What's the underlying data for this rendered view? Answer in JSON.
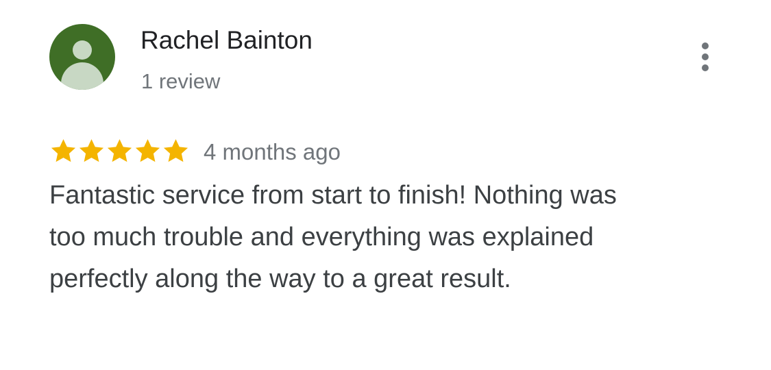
{
  "reviewer": {
    "name": "Rachel Bainton",
    "review_count": "1 review",
    "avatar_color": "#3f6e26"
  },
  "review": {
    "rating": 5,
    "max_rating": 5,
    "star_color": "#f4b400",
    "date": "4 months ago",
    "text": "Fantastic service from start to finish! Nothing was too much trouble and everything was explained perfectly along the way to a great result."
  },
  "icons": {
    "more": "more-vert-icon",
    "avatar": "person-icon",
    "star": "star-icon"
  }
}
